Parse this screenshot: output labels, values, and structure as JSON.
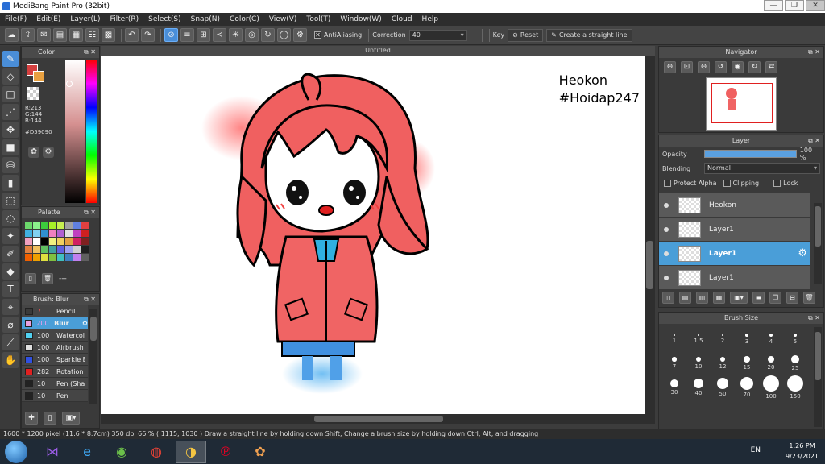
{
  "window": {
    "title": "MediBang Paint Pro (32bit)",
    "controls": [
      "—",
      "❐",
      "✕"
    ]
  },
  "menu": [
    "File(F)",
    "Edit(E)",
    "Layer(L)",
    "Filter(R)",
    "Select(S)",
    "Snap(N)",
    "Color(C)",
    "View(V)",
    "Tool(T)",
    "Window(W)",
    "Cloud",
    "Help"
  ],
  "toolbar": {
    "antialiasing_label": "AntiAliasing",
    "correction_label": "Correction",
    "correction_value": "40",
    "key_label": "Key",
    "reset_label": "Reset",
    "straight_line_label": "Create a straight line"
  },
  "color_panel": {
    "title": "Color",
    "primary_color": "#d59090",
    "r": "R:213",
    "g": "G:144",
    "b": "B:144",
    "hex": "#D59090"
  },
  "palette_panel": {
    "title": "Palette",
    "colors": [
      "#6cd86c",
      "#8cf08c",
      "#3ccc3c",
      "#a8f028",
      "#c8f050",
      "#a0a0a0",
      "#6080e0",
      "#e04040",
      "#40b0e0",
      "#80d0f0",
      "#3090d0",
      "#f080c0",
      "#b060d0",
      "#e0e0e0",
      "#c040c0",
      "#d02020",
      "#f0a0c0",
      "#ffffff",
      "#000000",
      "#f0f080",
      "#f0d060",
      "#e0a040",
      "#d02060",
      "#802020",
      "#e08040",
      "#f0c060",
      "#60c060",
      "#40a0a0",
      "#6060e0",
      "#a0a0f0",
      "#d0d0d0",
      "#202020",
      "#f06000",
      "#f0a000",
      "#e0e040",
      "#80c040",
      "#40c0c0",
      "#4080c0",
      "#c080f0",
      "#606060"
    ],
    "footer_label": "---"
  },
  "brush_panel": {
    "title": "Brush: Blur",
    "items": [
      {
        "size": "7",
        "name": "Pencil",
        "color": "#3a3a3a"
      },
      {
        "size": "200",
        "name": "Blur",
        "color": "#e8a0e0"
      },
      {
        "size": "100",
        "name": "Watercol",
        "color": "#50d0f0"
      },
      {
        "size": "100",
        "name": "Airbrush",
        "color": "#e0e0e0"
      },
      {
        "size": "100",
        "name": "Sparkle B",
        "color": "#3050e0"
      },
      {
        "size": "282",
        "name": "Rotation",
        "color": "#e02020"
      },
      {
        "size": "10",
        "name": "Pen (Sha",
        "color": "#222222"
      },
      {
        "size": "10",
        "name": "Pen",
        "color": "#222222"
      }
    ]
  },
  "canvas": {
    "tab_title": "Untitled",
    "text_line1": "Heokon",
    "text_line2": "#Hoidap247"
  },
  "navigator": {
    "title": "Navigator"
  },
  "layer_panel": {
    "title": "Layer",
    "opacity_label": "Opacity",
    "opacity_value": "100 %",
    "blending_label": "Blending",
    "blending_value": "Normal",
    "protect_alpha": "Protect Alpha",
    "clipping": "Clipping",
    "lock": "Lock",
    "layers": [
      {
        "name": "Heokon",
        "selected": false
      },
      {
        "name": "Layer1",
        "selected": false
      },
      {
        "name": "Layer1",
        "selected": true
      },
      {
        "name": "Layer1",
        "selected": false
      }
    ]
  },
  "brush_size_panel": {
    "title": "Brush Size",
    "sizes": [
      "1",
      "1.5",
      "2",
      "3",
      "4",
      "5",
      "7",
      "10",
      "12",
      "15",
      "20",
      "25",
      "30",
      "40",
      "50",
      "70",
      "100",
      "150"
    ]
  },
  "status": {
    "text": "1600 * 1200 pixel   (11.6 * 8.7cm)   350 dpi   66 %   ( 1115, 1030 )   Draw a straight line by holding down Shift, Change a brush size by holding down Ctrl, Alt, and dragging"
  },
  "taskbar": {
    "lang": "EN",
    "time": "1:26 PM",
    "date": "9/23/2021"
  }
}
